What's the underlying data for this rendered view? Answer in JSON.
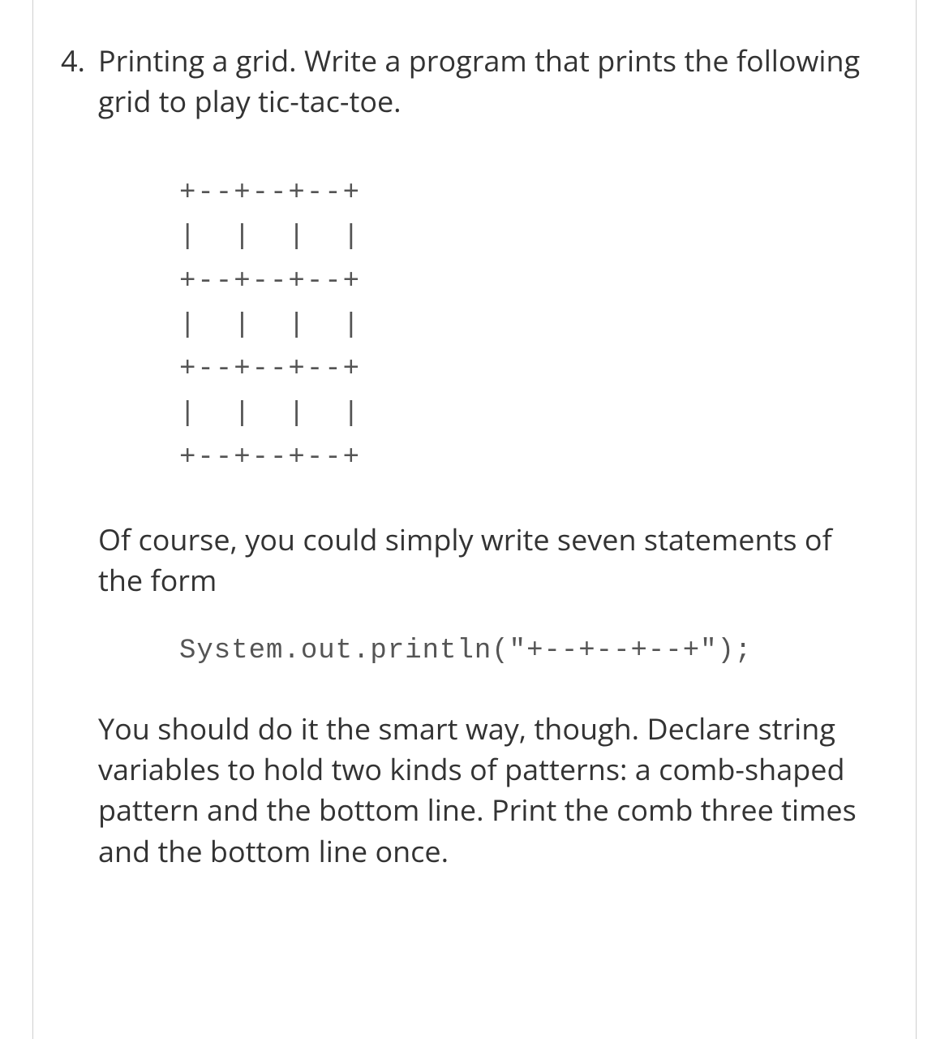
{
  "problem": {
    "number": "4.",
    "intro": "Printing a grid. Write a program that prints the following grid to play tic-tac-toe.",
    "grid_lines": [
      "+--+--+--+",
      "|  |  |  |",
      "+--+--+--+",
      "|  |  |  |",
      "+--+--+--+",
      "|  |  |  |",
      "+--+--+--+"
    ],
    "middle_text": "Of course, you could simply write seven statements of the form",
    "code_sample": "System.out.println(\"+--+--+--+\");",
    "conclusion": "You should do it the smart way, though. Declare string variables to hold two kinds of patterns: a comb-shaped pattern and the bottom line. Print the comb three times and the bottom line once."
  }
}
